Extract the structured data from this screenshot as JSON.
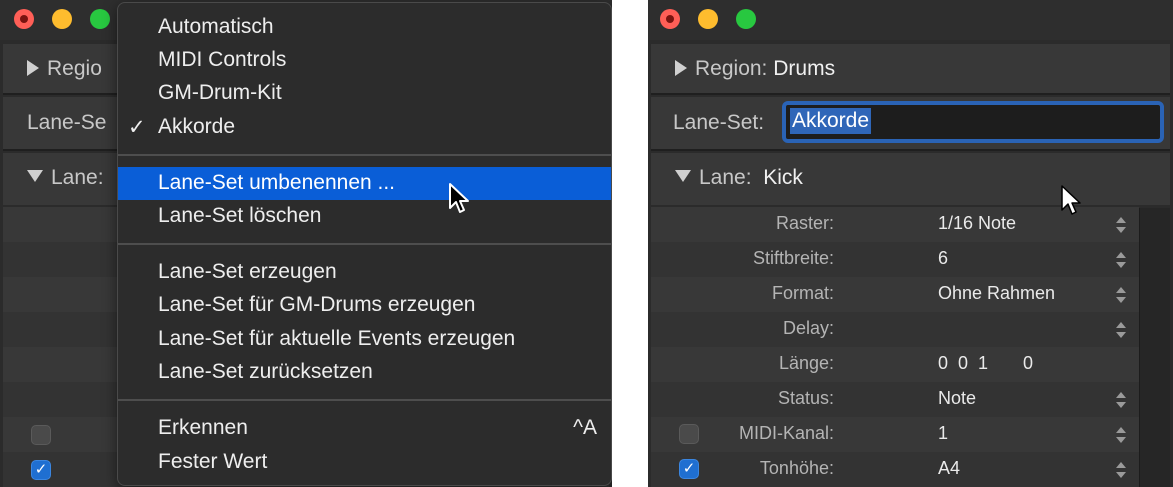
{
  "left_panel": {
    "region_label": "Regio",
    "laneset_label": "Lane-Se",
    "lane_label": "Lane:"
  },
  "menu": {
    "items_group1": [
      {
        "label": "Automatisch",
        "checked": false
      },
      {
        "label": "MIDI Controls",
        "checked": false
      },
      {
        "label": "GM-Drum-Kit",
        "checked": false
      },
      {
        "label": "Akkorde",
        "checked": true
      }
    ],
    "check_mark": "✓",
    "items_group2": [
      {
        "label": "Lane-Set umbenennen ...",
        "highlighted": true
      },
      {
        "label": "Lane-Set löschen",
        "highlighted": false
      }
    ],
    "items_group3": [
      {
        "label": "Lane-Set erzeugen"
      },
      {
        "label": "Lane-Set für GM-Drums erzeugen"
      },
      {
        "label": "Lane-Set für aktuelle Events erzeugen"
      },
      {
        "label": "Lane-Set zurücksetzen"
      }
    ],
    "items_group4": [
      {
        "label": "Erkennen",
        "shortcut": "^A"
      },
      {
        "label": "Fester Wert",
        "shortcut": ""
      }
    ]
  },
  "right_panel": {
    "region_label": "Region:",
    "region_value": "Drums",
    "laneset_label": "Lane-Set:",
    "laneset_value": "Akkorde",
    "lane_label": "Lane:",
    "lane_value": "Kick",
    "params": [
      {
        "label": "Raster:",
        "value": "1/16 Note"
      },
      {
        "label": "Stiftbreite:",
        "value": "6"
      },
      {
        "label": "Format:",
        "value": "Ohne Rahmen"
      },
      {
        "label": "Delay:",
        "value": ""
      },
      {
        "label": "Länge:",
        "value": "0  0  1       0"
      },
      {
        "label": "Status:",
        "value": "Note"
      },
      {
        "label": "MIDI-Kanal:",
        "value": "1"
      },
      {
        "label": "Tonhöhe:",
        "value": "A4"
      }
    ],
    "checkbox_midi_channel_checked": false,
    "checkbox_pitch_checked": true
  },
  "colors": {
    "window_bg": "#2b2b2b",
    "menu_highlight": "#0a5ed7",
    "text_selection": "#2f66b8",
    "traffic_red": "#ff5f57",
    "traffic_yellow": "#febc2e",
    "traffic_green": "#28c840"
  }
}
